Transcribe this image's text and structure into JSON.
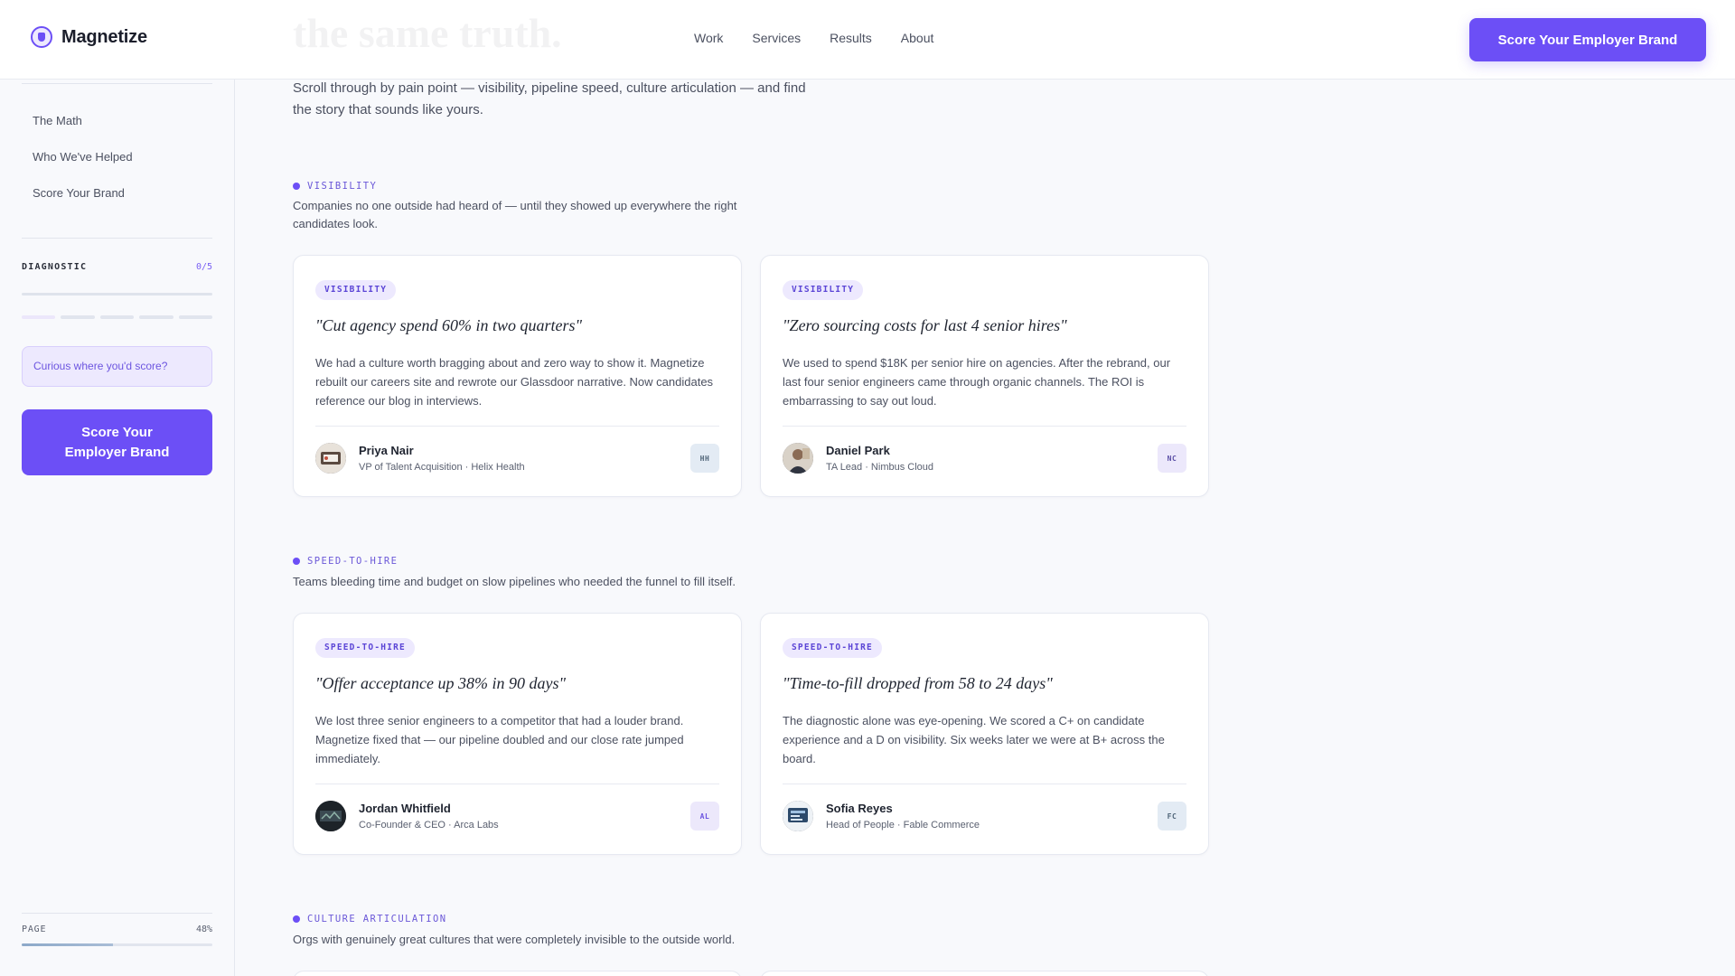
{
  "header": {
    "brand": "Magnetize",
    "nav": [
      "Work",
      "Services",
      "Results",
      "About"
    ],
    "cta": "Score Your Employer Brand",
    "ghost_heading": "the same truth."
  },
  "sidebar": {
    "links": [
      "The Math",
      "Who We've Helped",
      "Score Your Brand"
    ],
    "diagnostic_label": "DIAGNOSTIC",
    "diagnostic_count": "0/5",
    "diagnostic_progress": 0,
    "curious_text": "Curious where you'd score?",
    "cta": "Score Your Employer Brand",
    "page_label": "PAGE",
    "page_percent": "48%",
    "page_progress": 0.48
  },
  "main": {
    "intro": "Scroll through by pain point — visibility, pipeline speed, culture articulation — and find the story that sounds like yours.",
    "sections": [
      {
        "eyebrow": "VISIBILITY",
        "desc": "Companies no one outside had heard of — until they showed up everywhere the right candidates look.",
        "cards": [
          {
            "tag": "VISIBILITY",
            "quote": "\"Cut agency spend 60% in two quarters\"",
            "body": "We had a culture worth bragging about and zero way to show it. Magnetize rebuilt our careers site and rewrote our Glassdoor narrative. Now candidates reference our blog in interviews.",
            "name": "Priya Nair",
            "role": "VP of Talent Acquisition · Helix Health",
            "badge": "HH",
            "badge_bg": "#e3ebf4",
            "badge_fg": "#4f6478"
          },
          {
            "tag": "VISIBILITY",
            "quote": "\"Zero sourcing costs for last 4 senior hires\"",
            "body": "We used to spend $18K per senior hire on agencies. After the rebrand, our last four senior engineers came through organic channels. The ROI is embarrassing to say out loud.",
            "name": "Daniel Park",
            "role": "TA Lead · Nimbus Cloud",
            "badge": "NC",
            "badge_bg": "#ece8fb",
            "badge_fg": "#5b4fa6"
          }
        ]
      },
      {
        "eyebrow": "SPEED-TO-HIRE",
        "desc": "Teams bleeding time and budget on slow pipelines who needed the funnel to fill itself.",
        "cards": [
          {
            "tag": "SPEED-TO-HIRE",
            "quote": "\"Offer acceptance up 38% in 90 days\"",
            "body": "We lost three senior engineers to a competitor that had a louder brand. Magnetize fixed that — our pipeline doubled and our close rate jumped immediately.",
            "name": "Jordan Whitfield",
            "role": "Co-Founder & CEO · Arca Labs",
            "badge": "AL",
            "badge_bg": "#ece8fb",
            "badge_fg": "#6c55e0"
          },
          {
            "tag": "SPEED-TO-HIRE",
            "quote": "\"Time-to-fill dropped from 58 to 24 days\"",
            "body": "The diagnostic alone was eye-opening. We scored a C+ on candidate experience and a D on visibility. Six weeks later we were at B+ across the board.",
            "name": "Sofia Reyes",
            "role": "Head of People · Fable Commerce",
            "badge": "FC",
            "badge_bg": "#e3ebf4",
            "badge_fg": "#4f6478"
          }
        ]
      },
      {
        "eyebrow": "CULTURE ARTICULATION",
        "desc": "Orgs with genuinely great cultures that were completely invisible to the outside world."
      }
    ]
  }
}
